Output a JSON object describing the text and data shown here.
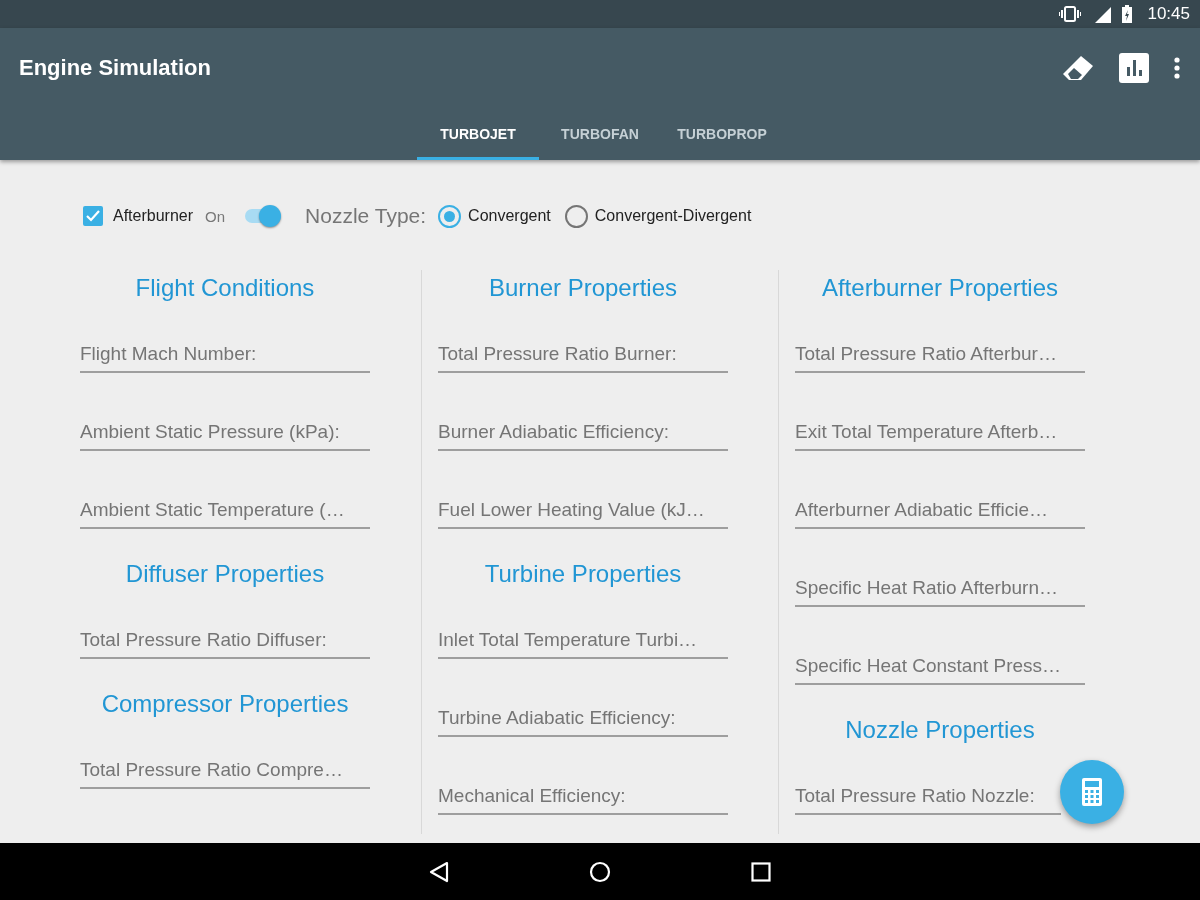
{
  "status_bar": {
    "time": "10:45"
  },
  "app_bar": {
    "title": "Engine Simulation"
  },
  "tabs": [
    {
      "label": "TURBOJET",
      "selected": true
    },
    {
      "label": "TURBOFAN",
      "selected": false
    },
    {
      "label": "TURBOPROP",
      "selected": false
    }
  ],
  "options": {
    "afterburner": {
      "label": "Afterburner",
      "checked": true
    },
    "switch": {
      "label": "On",
      "on": true
    },
    "nozzle_type": {
      "label": "Nozzle Type:",
      "choices": [
        {
          "label": "Convergent",
          "selected": true
        },
        {
          "label": "Convergent-Divergent",
          "selected": false
        }
      ]
    }
  },
  "columns": [
    {
      "sections": [
        {
          "title": "Flight Conditions",
          "fields": [
            {
              "placeholder": "Flight Mach Number:"
            },
            {
              "placeholder": "Ambient Static Pressure (kPa):"
            },
            {
              "placeholder": "Ambient Static Temperature (…"
            }
          ]
        },
        {
          "title": "Diffuser Properties",
          "fields": [
            {
              "placeholder": "Total Pressure Ratio Diffuser:"
            }
          ]
        },
        {
          "title": "Compressor Properties",
          "fields": [
            {
              "placeholder": "Total Pressure Ratio Compre…"
            }
          ]
        }
      ]
    },
    {
      "sections": [
        {
          "title": "Burner Properties",
          "fields": [
            {
              "placeholder": "Total Pressure Ratio Burner:"
            },
            {
              "placeholder": "Burner Adiabatic Efficiency:"
            },
            {
              "placeholder": "Fuel Lower Heating Value (kJ…"
            }
          ]
        },
        {
          "title": "Turbine Properties",
          "fields": [
            {
              "placeholder": "Inlet Total Temperature Turbi…"
            },
            {
              "placeholder": "Turbine Adiabatic Efficiency:"
            },
            {
              "placeholder": "Mechanical Efficiency:"
            }
          ]
        }
      ]
    },
    {
      "sections": [
        {
          "title": "Afterburner Properties",
          "fields": [
            {
              "placeholder": "Total Pressure Ratio Afterbur…"
            },
            {
              "placeholder": "Exit Total Temperature Afterb…"
            },
            {
              "placeholder": "Afterburner Adiabatic Efficie…"
            },
            {
              "placeholder": "Specific Heat Ratio Afterburn…"
            },
            {
              "placeholder": "Specific Heat Constant Press…"
            }
          ]
        },
        {
          "title": "Nozzle Properties",
          "fields": [
            {
              "placeholder": "Total Pressure Ratio Nozzle:"
            }
          ]
        }
      ]
    }
  ]
}
